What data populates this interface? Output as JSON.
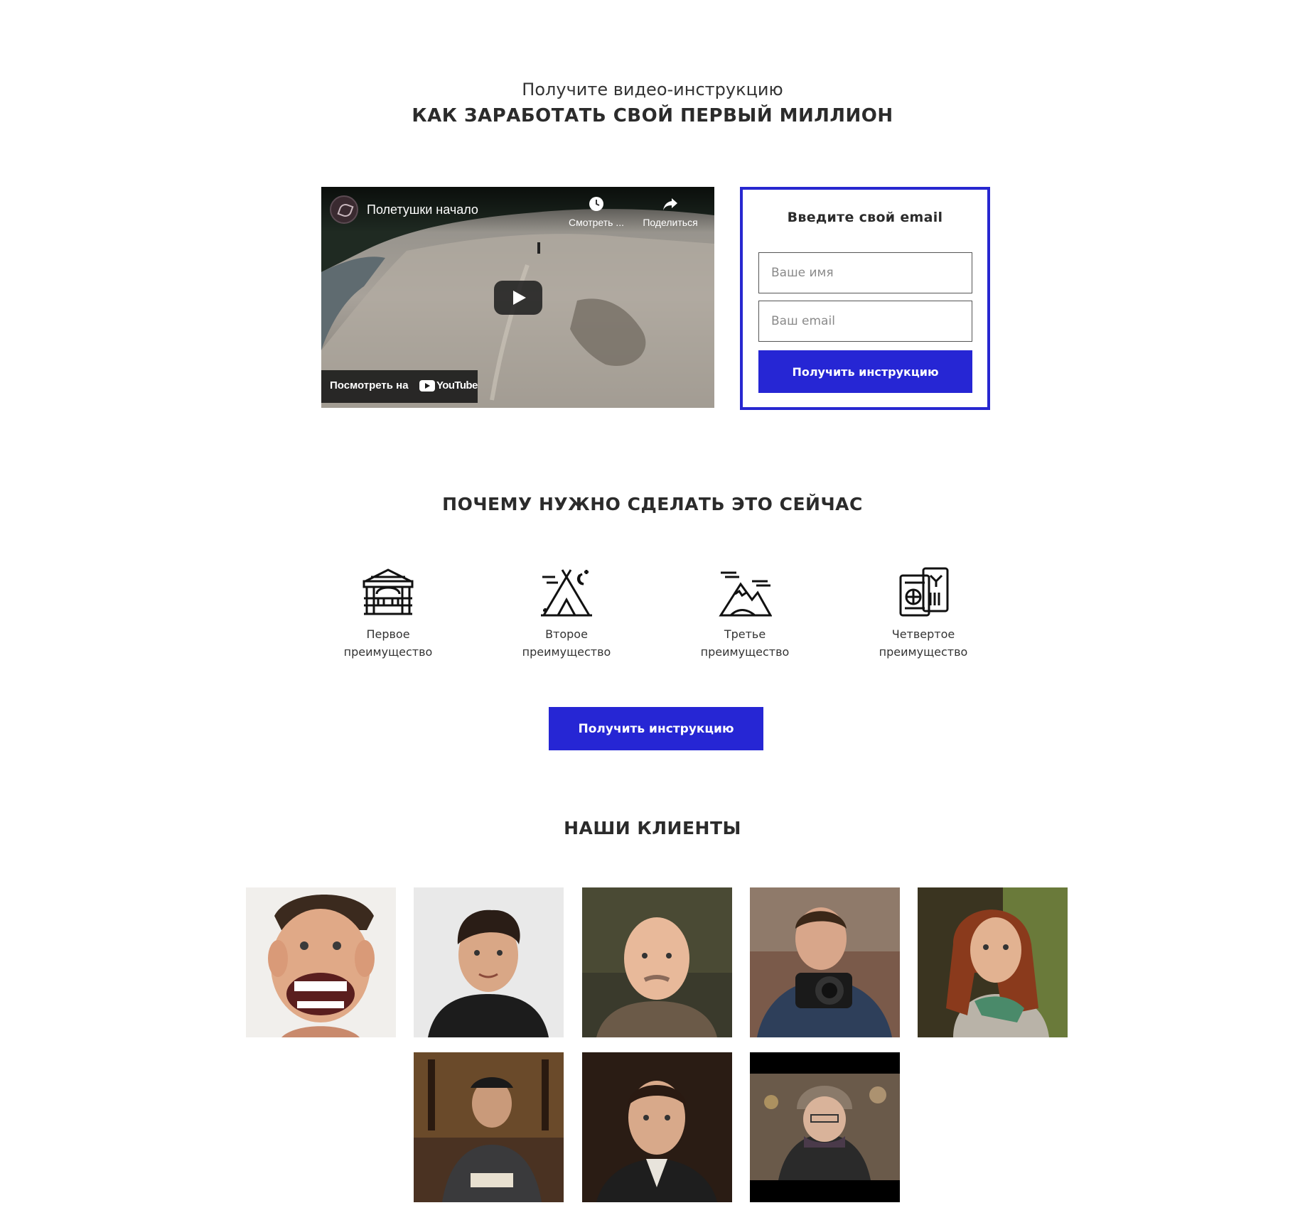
{
  "hero": {
    "subtitle": "Получите видео-инструкцию",
    "title": "КАК ЗАРАБОТАТЬ СВОЙ ПЕРВЫЙ МИЛЛИОН"
  },
  "video": {
    "title": "Полетушки начало",
    "watch_later_label": "Смотреть ...",
    "share_label": "Поделиться",
    "watch_on_label": "Посмотреть на",
    "yt_logo_text": "YouTube"
  },
  "form": {
    "title": "Введите свой email",
    "name_placeholder": "Ваше имя",
    "email_placeholder": "Ваш email",
    "submit_label": "Получить инструкцию",
    "accent_color": "#2626d4"
  },
  "why": {
    "title": "ПОЧЕМУ НУЖНО СДЕЛАТЬ ЭТО СЕЙЧАС",
    "benefits": [
      {
        "line1": "Первое",
        "line2": "преимущество",
        "icon": "pavilion-icon"
      },
      {
        "line1": "Второе",
        "line2": "преимущество",
        "icon": "tent-icon"
      },
      {
        "line1": "Третье",
        "line2": "преимущество",
        "icon": "mountains-icon"
      },
      {
        "line1": "Четвертое",
        "line2": "преимущество",
        "icon": "passport-ticket-icon"
      }
    ],
    "cta_label": "Получить инструкцию"
  },
  "clients": {
    "title": "НАШИ КЛИЕНТЫ"
  }
}
